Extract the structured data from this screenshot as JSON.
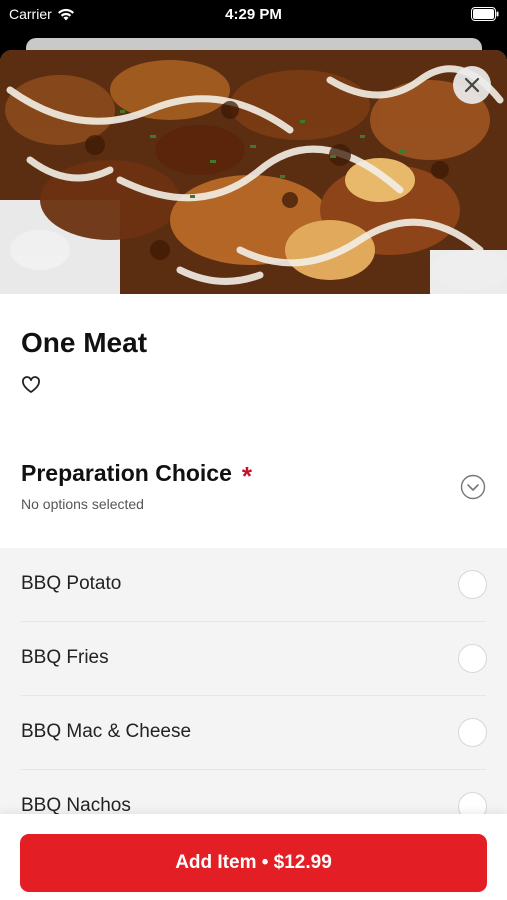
{
  "status_bar": {
    "carrier": "Carrier",
    "time": "4:29 PM"
  },
  "item": {
    "title": "One Meat"
  },
  "section": {
    "title": "Preparation Choice",
    "required_mark": "*",
    "subtitle": "No options selected"
  },
  "options": [
    {
      "label": "BBQ Potato",
      "selected": false
    },
    {
      "label": "BBQ Fries",
      "selected": false
    },
    {
      "label": "BBQ Mac & Cheese",
      "selected": false
    },
    {
      "label": "BBQ Nachos",
      "selected": false
    }
  ],
  "footer": {
    "add_button_label": "Add Item • $12.99"
  },
  "colors": {
    "accent": "#e31e24",
    "required": "#c8102e",
    "options_bg": "#f4f4f4"
  },
  "icons": {
    "wifi": "wifi-icon",
    "battery": "battery-icon",
    "close": "close-icon",
    "favorite": "heart-outline-icon",
    "collapse": "chevron-down-circle-icon"
  }
}
